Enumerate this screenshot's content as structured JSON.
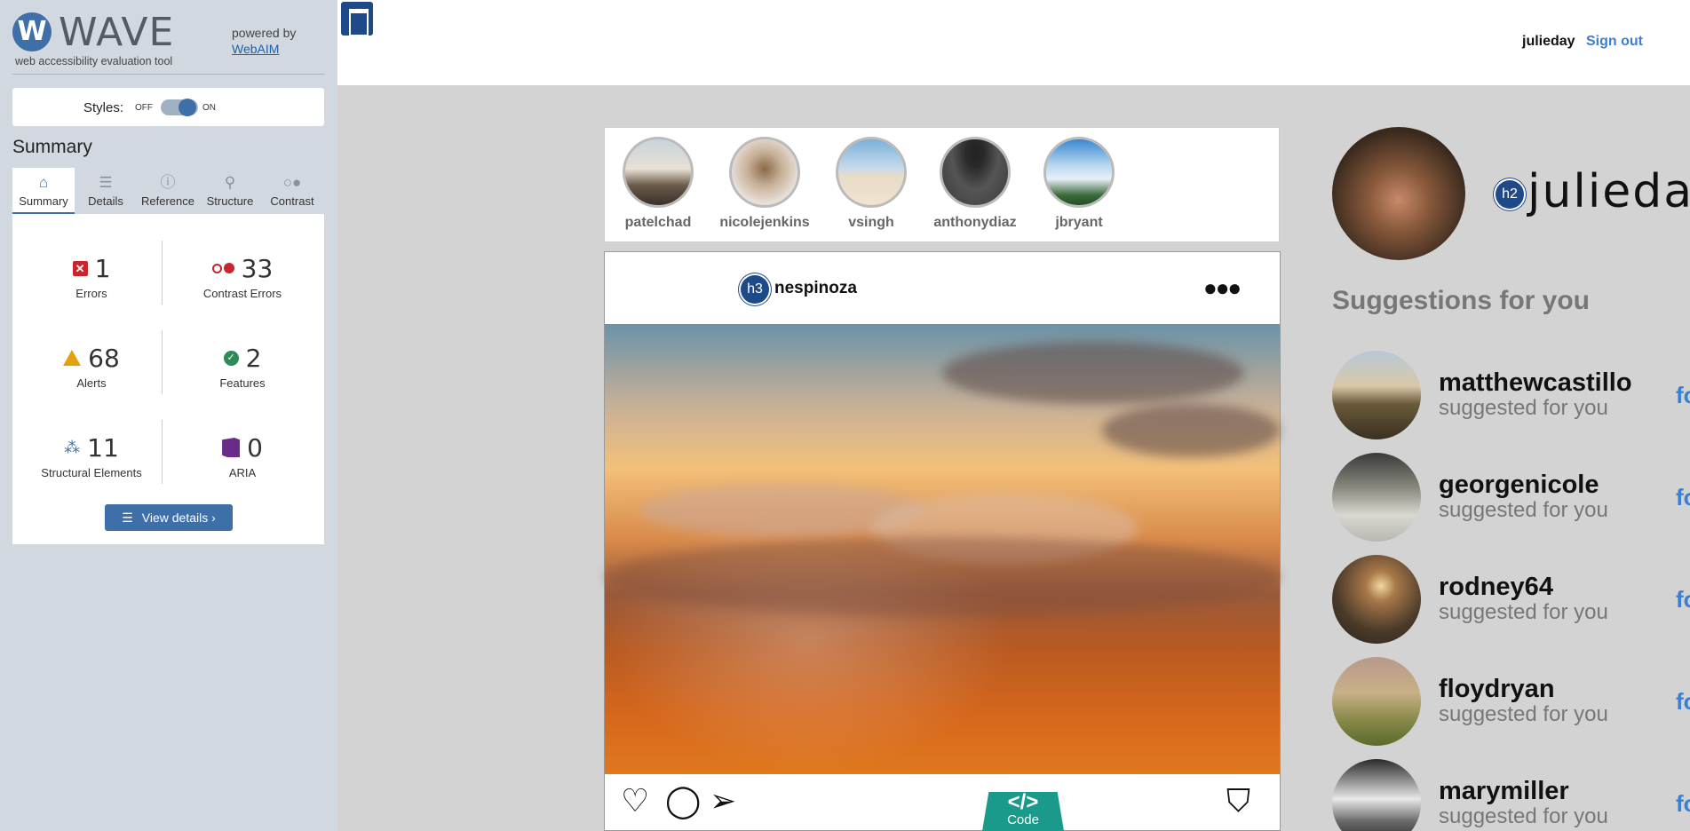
{
  "wave": {
    "logo_letter": "W",
    "title": "WAVE",
    "subtitle": "web accessibility evaluation tool",
    "powered_by": "powered by",
    "webaim_link": "WebAIM",
    "styles_label": "Styles:",
    "styles_off": "OFF",
    "styles_on": "ON",
    "summary_heading": "Summary",
    "tabs": [
      {
        "label": "Summary",
        "icon": "home-icon"
      },
      {
        "label": "Details",
        "icon": "list-icon"
      },
      {
        "label": "Reference",
        "icon": "info-icon"
      },
      {
        "label": "Structure",
        "icon": "sitemap-icon"
      },
      {
        "label": "Contrast",
        "icon": "contrast-icon"
      }
    ],
    "stats": {
      "errors": {
        "count": "1",
        "label": "Errors"
      },
      "contrast_errors": {
        "count": "33",
        "label": "Contrast Errors"
      },
      "alerts": {
        "count": "68",
        "label": "Alerts"
      },
      "features": {
        "count": "2",
        "label": "Features"
      },
      "structural": {
        "count": "11",
        "label": "Structural Elements"
      },
      "aria": {
        "count": "0",
        "label": "ARIA"
      }
    },
    "view_details": "View details ›",
    "colors": {
      "accent": "#3e6fa8",
      "error": "#c7262c",
      "alert": "#e5a00d",
      "feature": "#2e8b57",
      "aria": "#6a2c8b"
    }
  },
  "topbar": {
    "username": "julieday",
    "signout": "Sign out"
  },
  "stories": [
    {
      "name": "patelchad",
      "color": "#8a7a6a"
    },
    {
      "name": "nicolejenkins",
      "color": "#b8a898"
    },
    {
      "name": "vsingh",
      "color": "#a8c4d8"
    },
    {
      "name": "anthonydiaz",
      "color": "#4a4a4a"
    },
    {
      "name": "jbryant",
      "color": "#6a9ac8"
    }
  ],
  "post": {
    "heading_badge": "h3",
    "username": "nespinoza",
    "more": "●●●",
    "code_glyph": "</>",
    "code_label": "Code"
  },
  "profile": {
    "heading_badge": "h2",
    "name": "julieday",
    "suggestions_heading": "Suggestions for you"
  },
  "suggestions": [
    {
      "name": "matthewcastillo",
      "sub": "suggested for you",
      "action": "fo",
      "color": "#7a6a52"
    },
    {
      "name": "georgenicole",
      "sub": "suggested for you",
      "action": "fo",
      "color": "#8a8a80"
    },
    {
      "name": "rodney64",
      "sub": "suggested for you",
      "action": "fo",
      "color": "#6a5a48"
    },
    {
      "name": "floydryan",
      "sub": "suggested for you",
      "action": "fo",
      "color": "#a89a6a"
    },
    {
      "name": "marymiller",
      "sub": "suggested for you",
      "action": "fo",
      "color": "#3a3a3a"
    }
  ]
}
